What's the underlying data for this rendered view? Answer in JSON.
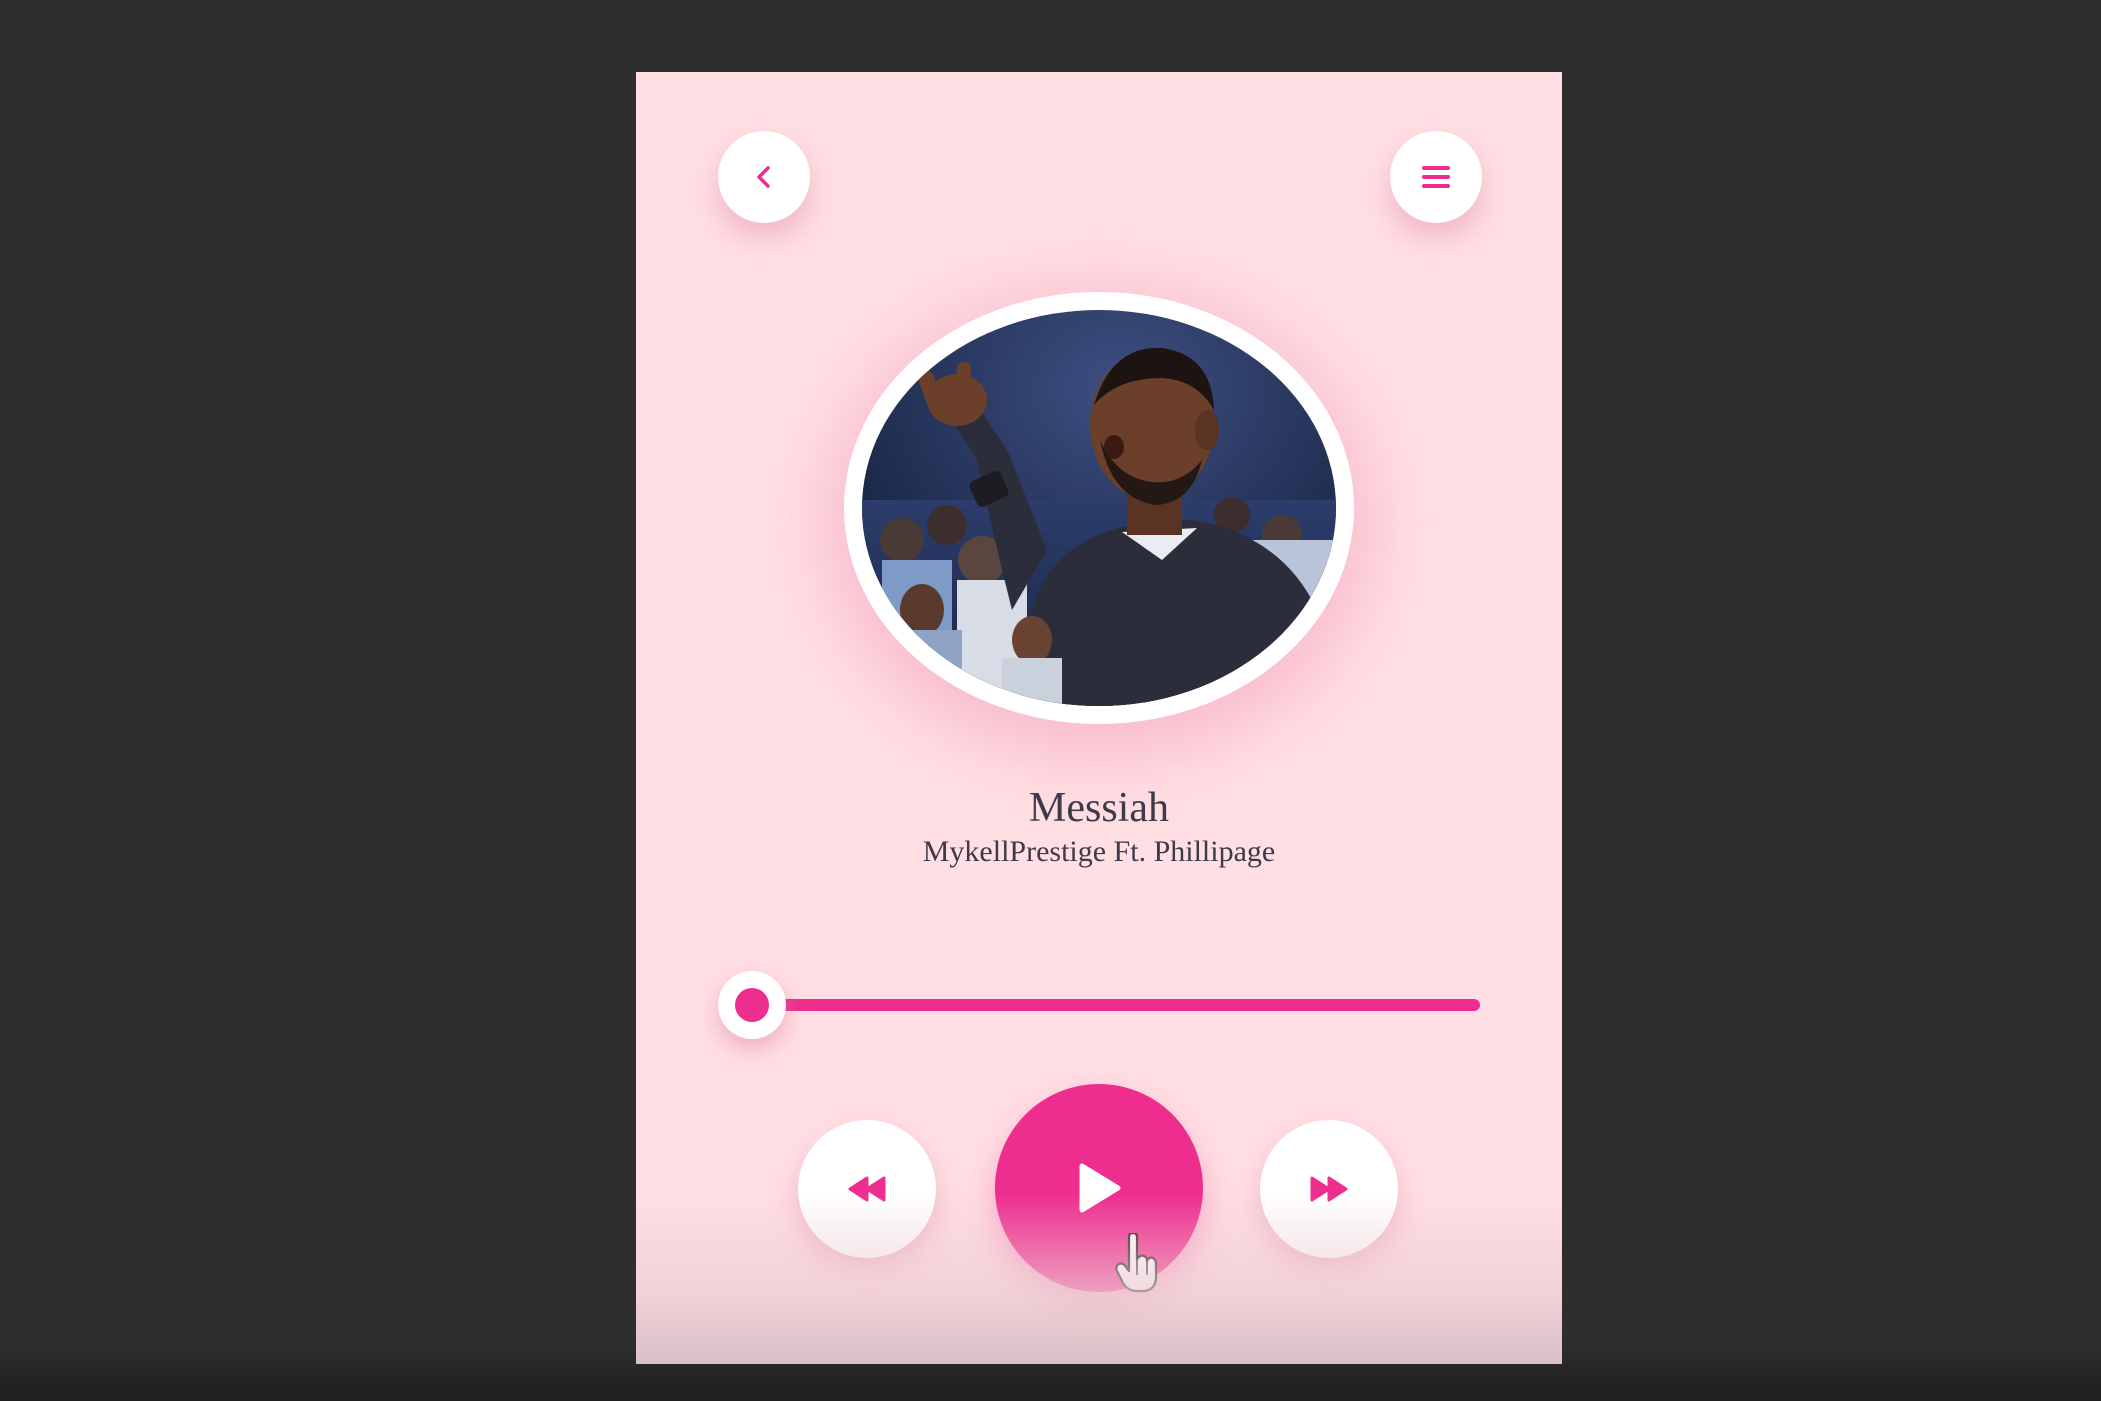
{
  "player": {
    "song_title": "Messiah",
    "song_artist": "MykellPrestige Ft. Phillipage",
    "progress_fraction": 0.0,
    "accent_color": "#ee2e8e",
    "background_color": "#ffdfe3"
  },
  "icons": {
    "back": "chevron-left-icon",
    "menu": "hamburger-menu-icon",
    "previous": "rewind-icon",
    "play": "play-icon",
    "next": "fast-forward-icon"
  }
}
